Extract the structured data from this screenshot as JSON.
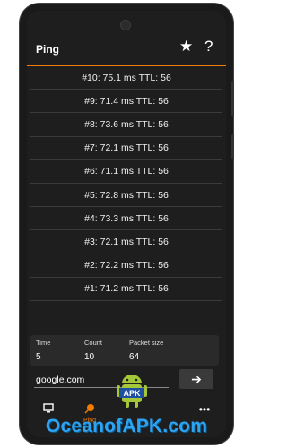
{
  "appbar": {
    "title": "Ping",
    "star_icon": "star-icon",
    "help_label": "?"
  },
  "results": [
    "#10: 75.1 ms TTL: 56",
    "#9: 71.4 ms TTL: 56",
    "#8: 73.6 ms TTL: 56",
    "#7: 72.1 ms TTL: 56",
    "#6: 71.1 ms TTL: 56",
    "#5: 72.8 ms TTL: 56",
    "#4: 73.3 ms TTL: 56",
    "#3: 72.1 ms TTL: 56",
    "#2: 72.2 ms TTL: 56",
    "#1: 71.2 ms TTL: 56"
  ],
  "form": {
    "time_label": "Time",
    "time_value": "5",
    "count_label": "Count",
    "count_value": "10",
    "packet_label": "Packet size",
    "packet_value": "64",
    "host_value": "google.com",
    "go_icon": "arrow-right-icon",
    "go_label": "➔"
  },
  "nav": {
    "ping_label": "Ping",
    "more_label": "•••"
  },
  "colors": {
    "accent": "#f57c00",
    "background": "#1e1e1e",
    "watermark": "#2ea3f2"
  },
  "watermark": {
    "text": "OceanofAPK.com",
    "logo_text": "APK"
  }
}
